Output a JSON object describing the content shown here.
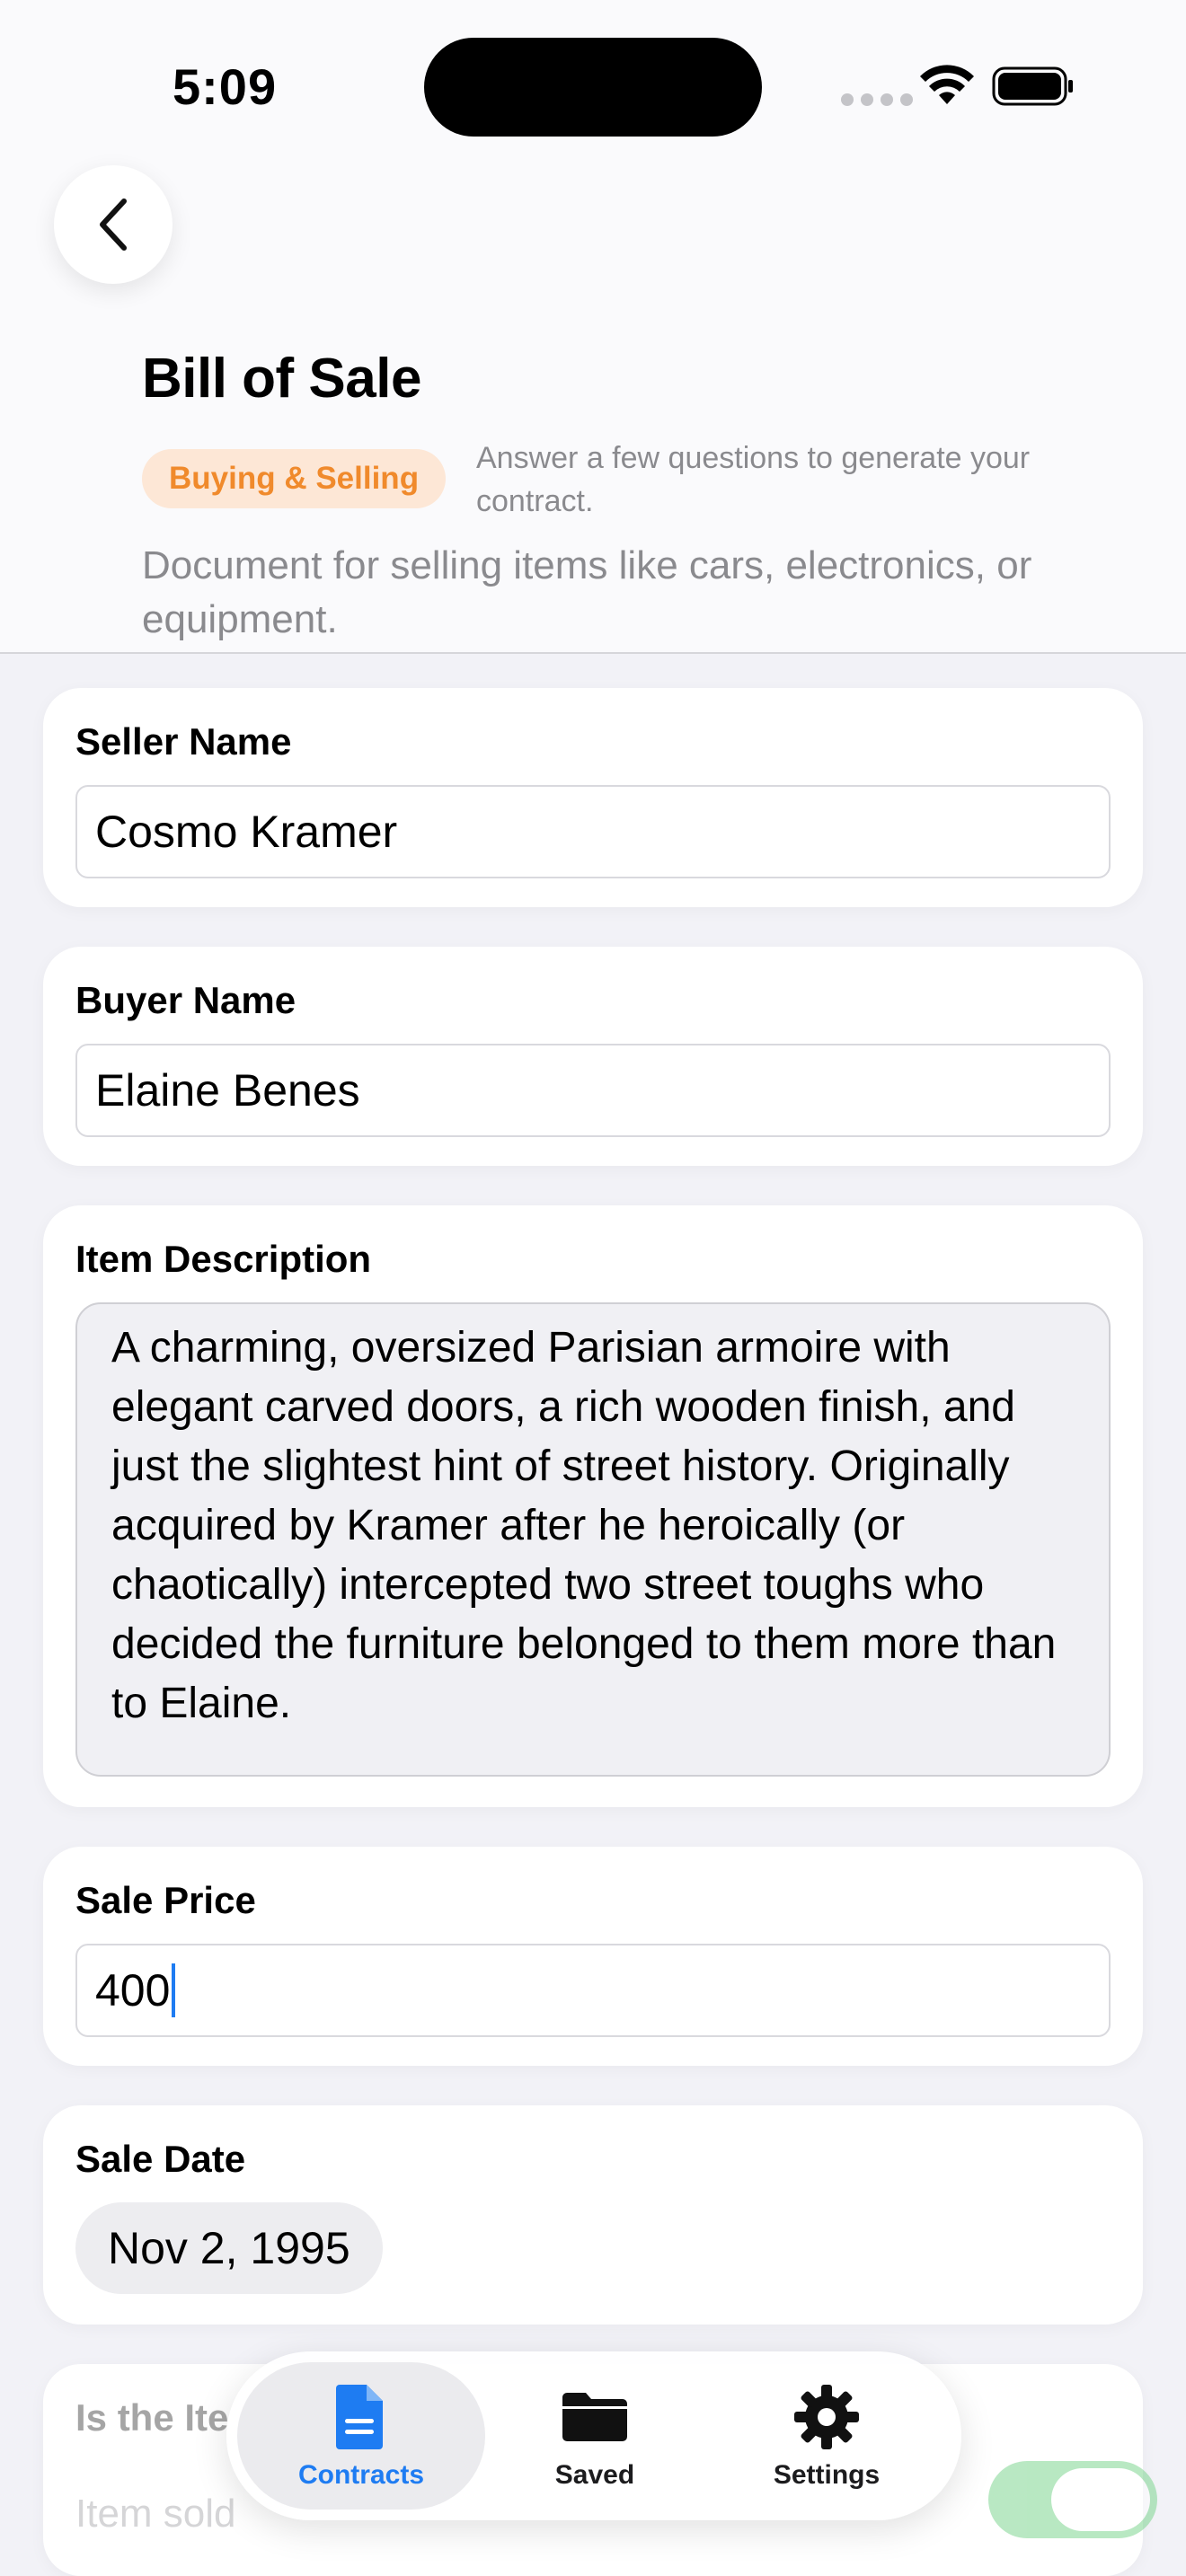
{
  "status_bar": {
    "time": "5:09"
  },
  "header": {
    "title": "Bill of Sale",
    "category": "Buying & Selling",
    "hint": "Answer a few questions to generate your contract.",
    "description": "Document for selling items like cars, electronics, or equipment."
  },
  "form": {
    "seller": {
      "label": "Seller Name",
      "value": "Cosmo Kramer"
    },
    "buyer": {
      "label": "Buyer Name",
      "value": "Elaine Benes"
    },
    "item": {
      "label": "Item Description",
      "value": "A charming, oversized Parisian armoire with elegant carved doors, a rich wooden finish, and just the slightest hint of street history. Originally acquired by Kramer after he heroically (or chaotically) intercepted two street toughs who decided the furniture belonged to them more than to Elaine."
    },
    "price": {
      "label": "Sale Price",
      "value": "400"
    },
    "date": {
      "label": "Sale Date",
      "value": "Nov 2, 1995"
    },
    "sold_as_is": {
      "label_visible": "Is the Ite",
      "label_tail": "?",
      "sub_visible": "Item sold",
      "enabled": true
    }
  },
  "tabbar": {
    "tabs": [
      {
        "label": "Contracts",
        "icon": "document-icon",
        "active": true
      },
      {
        "label": "Saved",
        "icon": "folder-icon",
        "active": false
      },
      {
        "label": "Settings",
        "icon": "gear-icon",
        "active": false
      }
    ]
  },
  "colors": {
    "accent": "#1e7cf2",
    "badge_text": "#f08a2c",
    "badge_bg": "#fde7d6",
    "toggle_on": "#7fd692"
  }
}
